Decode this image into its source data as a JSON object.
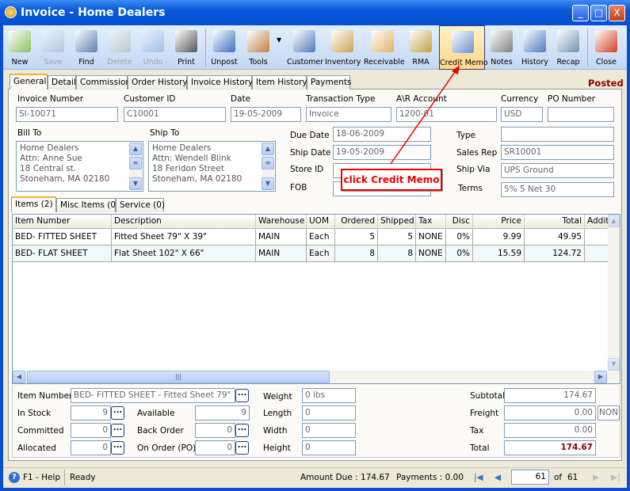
{
  "window": {
    "title": "Invoice - Home Dealers",
    "min": "_",
    "max": "□",
    "close": "X"
  },
  "toolbar": [
    {
      "label": "New",
      "icon": "new-doc-icon",
      "color": "#8BBF60",
      "enabled": true
    },
    {
      "label": "Save",
      "icon": "floppy-disk-icon",
      "color": "#8899AA",
      "enabled": false
    },
    {
      "label": "Find",
      "icon": "binoculars-icon",
      "color": "#5A7FB0",
      "enabled": true
    },
    {
      "label": "Delete",
      "icon": "recycle-bin-icon",
      "color": "#90A090",
      "enabled": false
    },
    {
      "label": "Undo",
      "icon": "undo-arrow-icon",
      "color": "#4A80D0",
      "enabled": false
    },
    {
      "label": "Print",
      "icon": "printer-icon",
      "color": "#555555",
      "enabled": true
    },
    {
      "label": "Unpost",
      "icon": "unpost-icon",
      "color": "#3A70C0",
      "enabled": true
    },
    {
      "label": "Tools",
      "icon": "tools-icon",
      "color": "#C08040",
      "enabled": true
    },
    {
      "label": "Customer",
      "icon": "person-icon",
      "color": "#4A7AC0",
      "enabled": true
    },
    {
      "label": "Inventory",
      "icon": "boxes-icon",
      "color": "#D0A050",
      "enabled": true
    },
    {
      "label": "Receivable",
      "icon": "receivable-icon",
      "color": "#E0B060",
      "enabled": true
    },
    {
      "label": "RMA",
      "icon": "rma-icon",
      "color": "#C0A040",
      "enabled": true
    },
    {
      "label": "Credit Memo",
      "icon": "credit-memo-icon",
      "color": "#6A8FC8",
      "enabled": true
    },
    {
      "label": "Notes",
      "icon": "notepad-icon",
      "color": "#808080",
      "enabled": true
    },
    {
      "label": "History",
      "icon": "history-person-icon",
      "color": "#4A7AC0",
      "enabled": true
    },
    {
      "label": "Recap",
      "icon": "recap-icon",
      "color": "#7090B0",
      "enabled": true
    },
    {
      "label": "Close",
      "icon": "close-doc-icon",
      "color": "#D04020",
      "enabled": true
    }
  ],
  "tabs": [
    "General",
    "Detail",
    "Commission",
    "Order History",
    "Invoice History",
    "Item History",
    "Payments"
  ],
  "status_label": "Posted",
  "header": {
    "invoice_number": {
      "label": "Invoice Number",
      "value": "SI-10071"
    },
    "customer_id": {
      "label": "Customer ID",
      "value": "C10001"
    },
    "date": {
      "label": "Date",
      "value": "19-05-2009"
    },
    "transaction_type": {
      "label": "Transaction Type",
      "value": "Invoice"
    },
    "ar_account": {
      "label": "A\\R Account",
      "value": "1200-01"
    },
    "currency": {
      "label": "Currency",
      "value": "USD"
    },
    "po_number": {
      "label": "PO Number",
      "value": ""
    }
  },
  "bill_to": {
    "label": "Bill To",
    "lines": [
      "Home Dealers",
      "Attn: Anne Sue",
      "18 Central st.",
      "Stoneham, MA 02180"
    ]
  },
  "ship_to": {
    "label": "Ship To",
    "lines": [
      "Home Dealers",
      "Attn: Wendell Blink",
      "18 Feridon Street",
      "Stoneham, MA 02180"
    ]
  },
  "mid": {
    "due_date": {
      "label": "Due Date",
      "value": "18-06-2009"
    },
    "ship_date": {
      "label": "Ship Date",
      "value": "19-05-2009"
    },
    "store_id": {
      "label": "Store ID",
      "value": ""
    },
    "fob": {
      "label": "FOB",
      "value": ""
    }
  },
  "right": {
    "type": {
      "label": "Type",
      "value": ""
    },
    "sales_rep": {
      "label": "Sales Rep",
      "value": "SR10001"
    },
    "ship_via": {
      "label": "Ship Via",
      "value": "UPS Ground"
    },
    "terms": {
      "label": "Terms",
      "value": "5% 5 Net 30"
    }
  },
  "callout": "click Credit Memo",
  "item_tabs": [
    "Items (2)",
    "Misc Items (0)",
    "Service (0)"
  ],
  "grid": {
    "columns": [
      "Item Number",
      "Description",
      "Warehouse",
      "UOM",
      "Ordered",
      "Shipped",
      "Tax",
      "Disc",
      "Price",
      "Total",
      "Addit"
    ],
    "rows": [
      [
        "BED- FITTED SHEET",
        "Fitted Sheet 79\" X 39\"",
        "MAIN",
        "Each",
        "5",
        "5",
        "NONE",
        "0%",
        "9.99",
        "49.95",
        ""
      ],
      [
        "BED- FLAT SHEET",
        "Flat Sheet 102\" X 66\"",
        "MAIN",
        "Each",
        "8",
        "8",
        "NONE",
        "0%",
        "15.59",
        "124.72",
        ""
      ]
    ]
  },
  "bottom": {
    "item_number": {
      "label": "Item Number",
      "value": "BED- FITTED SHEET - Fitted Sheet 79\" X 39\""
    },
    "in_stock": {
      "label": "In Stock",
      "value": "9"
    },
    "committed": {
      "label": "Committed",
      "value": "0"
    },
    "allocated": {
      "label": "Allocated",
      "value": "0"
    },
    "available": {
      "label": "Available",
      "value": "9"
    },
    "back_order": {
      "label": "Back Order",
      "value": "0"
    },
    "on_order": {
      "label": "On Order (PO)",
      "value": "0"
    },
    "weight": {
      "label": "Weight",
      "value": "0 lbs"
    },
    "length": {
      "label": "Length",
      "value": "0"
    },
    "width": {
      "label": "Width",
      "value": "0"
    },
    "height": {
      "label": "Height",
      "value": "0"
    },
    "subtotal": {
      "label": "Subtotal",
      "value": "174.67"
    },
    "freight": {
      "label": "Freight",
      "value": "0.00",
      "code": "NON"
    },
    "tax": {
      "label": "Tax",
      "value": "0.00"
    },
    "total": {
      "label": "Total",
      "value": "174.67"
    }
  },
  "statusbar": {
    "help": "F1 - Help",
    "state": "Ready",
    "amount_due": "Amount Due : 174.67",
    "payments": "Payments : 0.00",
    "page": "61",
    "of": "of",
    "total_pages": "61"
  }
}
